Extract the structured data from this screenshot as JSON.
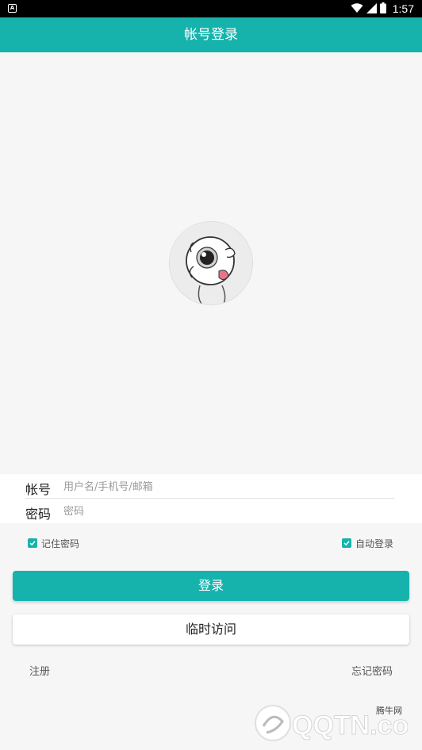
{
  "status_bar": {
    "time": "1:57",
    "icons": [
      "app-notification-icon",
      "wifi-icon",
      "cellular-signal-icon",
      "battery-icon"
    ]
  },
  "header": {
    "title": "帐号登录"
  },
  "form": {
    "account_label": "帐号",
    "account_placeholder": "用户名/手机号/邮箱",
    "password_label": "密码",
    "password_placeholder": "密码"
  },
  "options": {
    "remember_password": {
      "label": "记住密码",
      "checked": true
    },
    "auto_login": {
      "label": "自动登录",
      "checked": true
    }
  },
  "buttons": {
    "login": "登录",
    "guest_visit": "临时访问"
  },
  "links": {
    "register": "注册",
    "forgot_password": "忘记密码"
  },
  "watermark": {
    "text": "QQTN.com",
    "site_label": "腾牛网"
  },
  "colors": {
    "accent": "#16b3ad",
    "background": "#f6f6f7",
    "status_bar": "#000000"
  }
}
